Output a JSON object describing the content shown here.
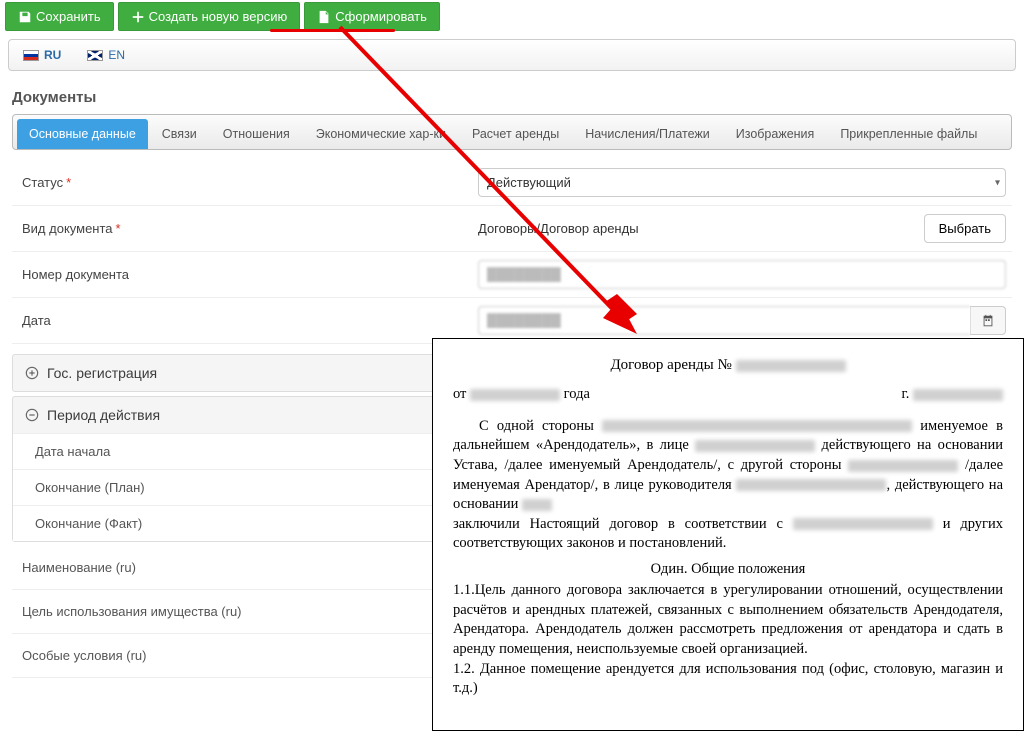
{
  "toolbar": {
    "save": "Сохранить",
    "new_version": "Создать новую версию",
    "generate": "Сформировать"
  },
  "lang": {
    "ru": "RU",
    "en": "EN"
  },
  "section_title": "Документы",
  "tabs": [
    "Основные данные",
    "Связи",
    "Отношения",
    "Экономические хар-ки",
    "Расчет аренды",
    "Начисления/Платежи",
    "Изображения",
    "Прикрепленные файлы"
  ],
  "form": {
    "status_label": "Статус",
    "status_value": "Действующий",
    "doctype_label": "Вид документа",
    "doctype_value": "Договоры/Договор аренды",
    "choose_label": "Выбрать",
    "docnum_label": "Номер документа",
    "docnum_value": "████████",
    "date_label": "Дата",
    "date_value": "████████"
  },
  "panels": {
    "gosreg": "Гос. регистрация",
    "period": "Период действия",
    "start_date": "Дата начала",
    "end_plan": "Окончание (План)",
    "end_fact": "Окончание (Факт)"
  },
  "extra_rows": {
    "name_ru": "Наименование (ru)",
    "purpose_ru": "Цель использования имущества (ru)",
    "special_ru": "Особые условия (ru)"
  },
  "doc": {
    "title_prefix": "Договор аренды № ",
    "from": "от",
    "year_word": "года",
    "city_prefix": "г.",
    "p1_a": "С одной стороны",
    "p1_b": "именуемое в дальнейшем «Арендодатель», в лице",
    "p1_c": "действующего на основании Устава, /далее именуемый Арендодатель/, с другой стороны",
    "p1_d": "/далее именуемая Арендатор/, в лице руководителя",
    "p1_e": ", действующего на основании",
    "p1_f": "заключили Настоящий договор в соответствии с",
    "p1_g": "и других соответствующих законов и постановлений.",
    "section1": "Один. Общие положения",
    "p11": "1.1.Цель данного договора заключается в урегулировании отношений, осуществлении расчётов и арендных платежей, связанных с   выполнением обязательств Арендодателя, Арендатора. Арендодатель должен рассмотреть предложения от арендатора и сдать в аренду помещения, неиспользуемые своей организацией.",
    "p12": "1.2. Данное помещение арендуется для использования под (офис, столовую, магазин и т.д.)"
  }
}
